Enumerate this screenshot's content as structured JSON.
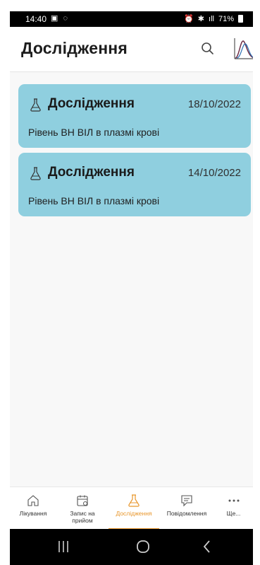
{
  "status_bar": {
    "time": "14:40",
    "battery": "71%"
  },
  "header": {
    "title": "Дослідження"
  },
  "studies": [
    {
      "title": "Дослідження",
      "date": "18/10/2022",
      "subtitle": "Рівень ВН ВІЛ в плазмі крові"
    },
    {
      "title": "Дослідження",
      "date": "14/10/2022",
      "subtitle": "Рівень ВН ВІЛ в плазмі крові"
    }
  ],
  "bottom_nav": {
    "items": [
      {
        "label": "Лікування",
        "icon": "house-icon"
      },
      {
        "label": "Запис на прийом",
        "icon": "calendar-icon"
      },
      {
        "label": "Дослідження",
        "icon": "flask-icon",
        "active": true
      },
      {
        "label": "Повідомлення",
        "icon": "message-icon"
      },
      {
        "label": "Ще...",
        "icon": "more-icon"
      }
    ]
  },
  "colors": {
    "card_background": "#8fcfdf",
    "active_accent": "#e8962b",
    "chart_curve_dark": "#6b2740",
    "chart_curve_blue": "#2b6fb3"
  }
}
